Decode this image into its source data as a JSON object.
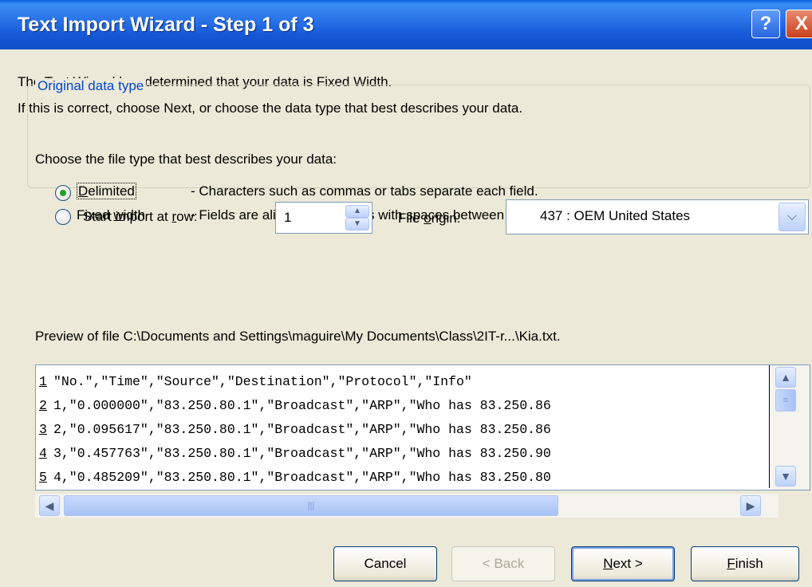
{
  "window": {
    "title": "Text Import Wizard - Step 1 of 3",
    "help_label": "?",
    "close_label": "X"
  },
  "intro": {
    "line1": "The Text Wizard has determined that your data is Fixed Width.",
    "line2": "If this is correct, choose Next, or choose the data type that best describes your data."
  },
  "data_type_group": {
    "legend": "Original data type",
    "prompt": "Choose the file type that best describes your data:",
    "options": [
      {
        "label": "Delimited",
        "description": "- Characters such as commas or tabs separate each field.",
        "selected": true
      },
      {
        "label": "Fixed width",
        "description": "- Fields are aligned in columns with spaces between each field.",
        "selected": false
      }
    ]
  },
  "start_row": {
    "label": "Start import at row:",
    "value": "1"
  },
  "file_origin": {
    "label": "File origin:",
    "value": "437 : OEM United States"
  },
  "preview": {
    "label": "Preview of file C:\\Documents and Settings\\maguire\\My Documents\\Class\\2IT-r...\\Kia.txt.",
    "rows": [
      {
        "num": "1",
        "text": "\"No.\",\"Time\",\"Source\",\"Destination\",\"Protocol\",\"Info\""
      },
      {
        "num": "2",
        "text": "1,\"0.000000\",\"83.250.80.1\",\"Broadcast\",\"ARP\",\"Who has 83.250.86"
      },
      {
        "num": "3",
        "text": "2,\"0.095617\",\"83.250.80.1\",\"Broadcast\",\"ARP\",\"Who has 83.250.86"
      },
      {
        "num": "4",
        "text": "3,\"0.457763\",\"83.250.80.1\",\"Broadcast\",\"ARP\",\"Who has 83.250.90"
      },
      {
        "num": "5",
        "text": "4,\"0.485209\",\"83.250.80.1\",\"Broadcast\",\"ARP\",\"Who has 83.250.80"
      }
    ]
  },
  "buttons": {
    "cancel": "Cancel",
    "back": "< Back",
    "next": "Next >",
    "finish": "Finish"
  }
}
